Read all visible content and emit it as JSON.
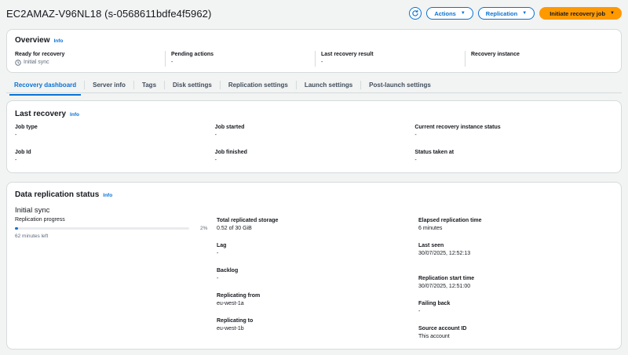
{
  "header": {
    "title": "EC2AMAZ-V96NL18 (s-0568611bdfe4f5962)",
    "actions_label": "Actions",
    "replication_label": "Replication",
    "initiate_label": "Initiate recovery job"
  },
  "overview": {
    "title": "Overview",
    "info": "Info",
    "cols": [
      {
        "label": "Ready for recovery",
        "value": "Initial sync"
      },
      {
        "label": "Pending actions",
        "value": "-"
      },
      {
        "label": "Last recovery result",
        "value": "-"
      },
      {
        "label": "Recovery instance",
        "value": ""
      }
    ]
  },
  "tabs": [
    "Recovery dashboard",
    "Server info",
    "Tags",
    "Disk settings",
    "Replication settings",
    "Launch settings",
    "Post-launch settings"
  ],
  "last_recovery": {
    "title": "Last recovery",
    "info": "Info",
    "job_type": {
      "label": "Job type",
      "value": "-"
    },
    "job_started": {
      "label": "Job started",
      "value": "-"
    },
    "current_status": {
      "label": "Current recovery instance status",
      "value": "-"
    },
    "job_id": {
      "label": "Job Id",
      "value": "-"
    },
    "job_finished": {
      "label": "Job finished",
      "value": "-"
    },
    "status_taken": {
      "label": "Status taken at",
      "value": "-"
    }
  },
  "data_replication": {
    "title": "Data replication status",
    "info": "Info",
    "state": "Initial sync",
    "progress_label": "Replication progress",
    "progress_percent": 2,
    "progress_text": "2%",
    "time_left": "62 minutes left",
    "total_storage": {
      "label": "Total replicated storage",
      "value": "0.52 of 30 GiB"
    },
    "lag": {
      "label": "Lag",
      "value": "-"
    },
    "backlog": {
      "label": "Backlog",
      "value": "-"
    },
    "replicating_from": {
      "label": "Replicating from",
      "value": "eu-west-1a"
    },
    "replicating_to": {
      "label": "Replicating to",
      "value": "eu-west-1b"
    },
    "elapsed": {
      "label": "Elapsed replication time",
      "value": "6 minutes"
    },
    "last_seen": {
      "label": "Last seen",
      "value": "30/07/2025, 12:52:13"
    },
    "start_time": {
      "label": "Replication start time",
      "value": "30/07/2025, 12:51:00"
    },
    "failing_back": {
      "label": "Failing back",
      "value": "-"
    },
    "source_account": {
      "label": "Source account ID",
      "value": "This account"
    }
  },
  "colors": {
    "accent": "#0972d3",
    "primary_button": "#ff9900"
  }
}
